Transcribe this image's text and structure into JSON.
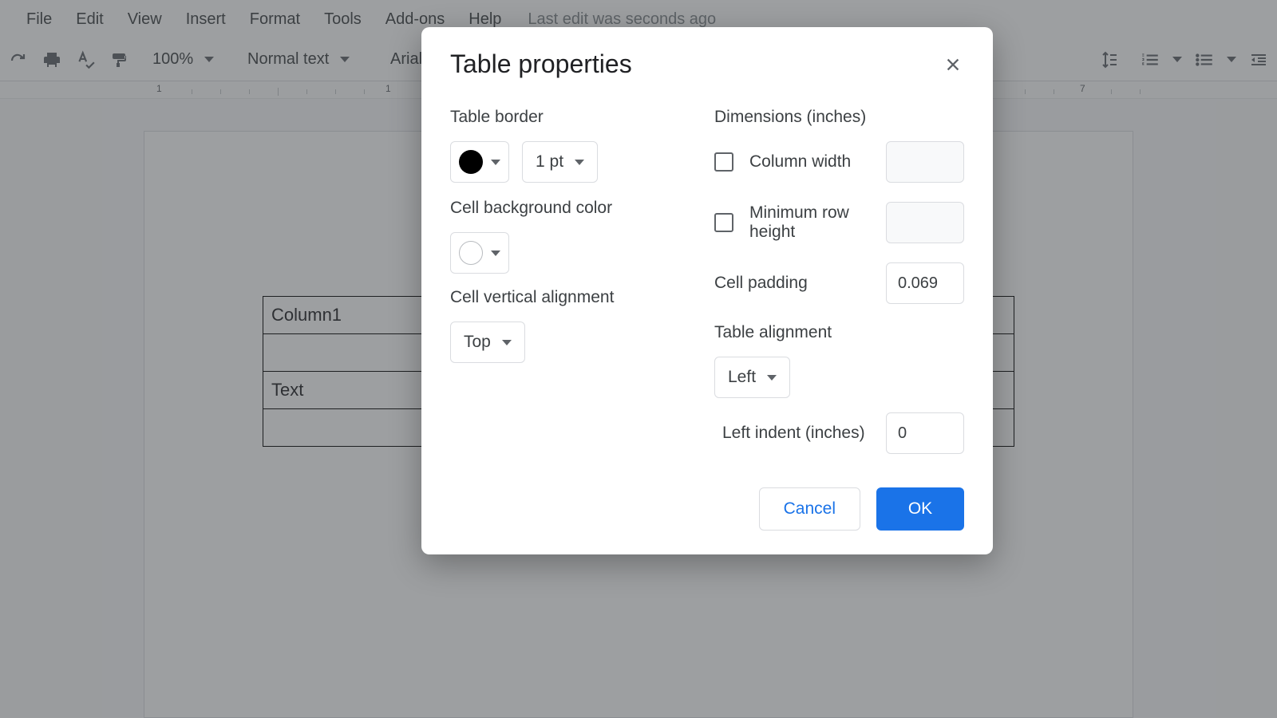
{
  "menubar": {
    "items": [
      "File",
      "Edit",
      "View",
      "Insert",
      "Format",
      "Tools",
      "Add-ons",
      "Help"
    ],
    "edit_status": "Last edit was seconds ago"
  },
  "toolbar": {
    "zoom": "100%",
    "style": "Normal text",
    "font": "Arial"
  },
  "ruler": {
    "marks": [
      "1",
      "1",
      "7"
    ]
  },
  "table": {
    "rows": [
      {
        "c1": "Column1",
        "c2": ""
      },
      {
        "c1": "",
        "c2": ""
      },
      {
        "c1": "Text",
        "c2": ""
      },
      {
        "c1": "",
        "c2": ""
      }
    ]
  },
  "dialog": {
    "title": "Table properties",
    "left": {
      "border_label": "Table border",
      "border_width": "1 pt",
      "bg_label": "Cell background color",
      "valign_label": "Cell vertical alignment",
      "valign_value": "Top"
    },
    "right": {
      "dims_label": "Dimensions  (inches)",
      "col_width_label": "Column width",
      "row_height_label": "Minimum row height",
      "cell_padding_label": "Cell padding",
      "cell_padding_value": "0.069",
      "alignment_label": "Table alignment",
      "alignment_value": "Left",
      "indent_label": "Left indent  (inches)",
      "indent_value": "0"
    },
    "cancel": "Cancel",
    "ok": "OK"
  }
}
